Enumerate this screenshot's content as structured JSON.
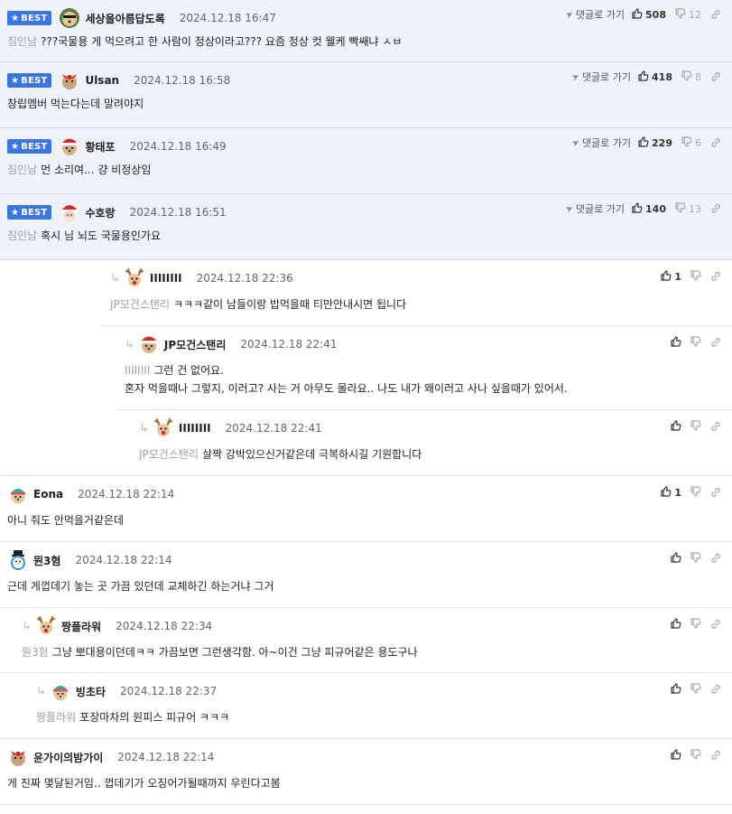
{
  "colors": {
    "best_bg": "#eef2fb",
    "badge": "#3a76e3",
    "mention": "#9aa0ab",
    "divider": "#dde3ee"
  },
  "labels": {
    "best": "BEST",
    "goto": "댓글로 가기"
  },
  "comments": [
    {
      "best": true,
      "avatar": "sunglasses-dog-avatar",
      "nick": "세상을아름답도록",
      "time": "2024.12.18 16:47",
      "mention": "짐인남",
      "lines": [
        "???국물용 게 먹으려고 한 사람이 정상이라고??? 요즘 정상 컷 웰케 빡쌔냐 ㅅㅂ"
      ],
      "up": "508",
      "down": "12"
    },
    {
      "best": true,
      "avatar": "wreath-avatar",
      "nick": "Ulsan",
      "time": "2024.12.18 16:58",
      "mention": "",
      "lines": [
        "창립멤버 먹는다는데 말려야지"
      ],
      "up": "418",
      "down": "8"
    },
    {
      "best": true,
      "avatar": "santa-dog-avatar",
      "nick": "황태포",
      "time": "2024.12.18 16:49",
      "mention": "짐인남",
      "lines": [
        "먼 소리여... 걍 비정상임"
      ],
      "up": "229",
      "down": "6"
    },
    {
      "best": true,
      "avatar": "santa-avatar",
      "nick": "수호랑",
      "time": "2024.12.18 16:51",
      "mention": "짐인남",
      "lines": [
        "혹시 님 뇌도 국물용인가요"
      ],
      "up": "140",
      "down": "13"
    },
    {
      "best": false,
      "reply": true,
      "avatar": "reindeer-avatar",
      "nick": "IIIIIIII",
      "time": "2024.12.18 22:36",
      "mention": "JP모건스탠리",
      "lines": [
        "ㅋㅋㅋ같이 남들이랑 밥먹을때 티만안내시면 됩니다"
      ],
      "up": "1",
      "down": ""
    },
    {
      "best": false,
      "reply": true,
      "avatar": "santa-dog-avatar",
      "nick": "JP모건스탠리",
      "time": "2024.12.18 22:41",
      "mention": "IIIIIIII",
      "lines": [
        "그런 건 없어요.",
        "혼자 먹을때나 그렇지, 이러고? 사는 거 아무도 몰라요.. 나도 내가 왜이러고 사나 싶을때가 있어서."
      ],
      "up": "",
      "down": ""
    },
    {
      "best": false,
      "reply": true,
      "avatar": "reindeer-avatar",
      "nick": "IIIIIIII",
      "time": "2024.12.18 22:41",
      "mention": "JP모건스탠리",
      "lines": [
        "살짝 강박있으신거같은데 극복하시길 기원합니다"
      ],
      "up": "",
      "down": ""
    },
    {
      "best": false,
      "reply": false,
      "avatar": "winter-hat-avatar",
      "nick": "Eona",
      "time": "2024.12.18 22:14",
      "mention": "",
      "lines": [
        "아니 줘도 안먹을거같은데"
      ],
      "up": "1",
      "down": ""
    },
    {
      "best": false,
      "reply": false,
      "avatar": "snowman-avatar",
      "nick": "뭔3혐",
      "time": "2024.12.18 22:14",
      "mention": "",
      "lines": [
        "근데 게껍데기 놓는 곳 가끔 있던데 교체하긴 하는거냐 그거"
      ],
      "up": "",
      "down": ""
    },
    {
      "best": false,
      "reply": true,
      "avatar": "reindeer-avatar",
      "nick": "짱플라워",
      "time": "2024.12.18 22:34",
      "mention": "뭔3혐",
      "lines": [
        "그냥 뽀대용이던데ㅋㅋ 가끔보면 그런생각함. 아~이건 그냥 피규어같은 용도구나"
      ],
      "up": "",
      "down": ""
    },
    {
      "best": false,
      "reply": true,
      "avatar": "winter-hat-avatar",
      "nick": "빙초타",
      "time": "2024.12.18 22:37",
      "mention": "짱플라워",
      "lines": [
        "포장마차의 원피스 피규어 ㅋㅋㅋ"
      ],
      "up": "",
      "down": ""
    },
    {
      "best": false,
      "reply": false,
      "avatar": "wreath-avatar",
      "nick": "윤가이의밤가이",
      "time": "2024.12.18 22:14",
      "mention": "",
      "lines": [
        "게 진짜 몇달된거임.. 껍데기가 오징어가될때까지 우린다고봄"
      ],
      "up": "",
      "down": ""
    }
  ]
}
